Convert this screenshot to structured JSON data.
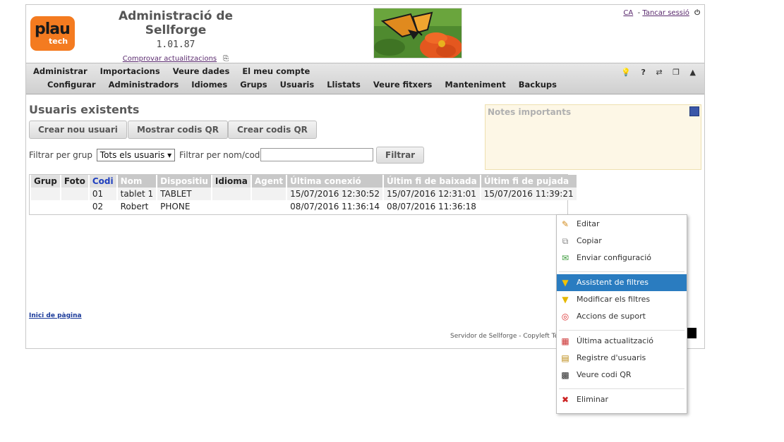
{
  "header": {
    "logo_top": "plau",
    "logo_bottom": "tech",
    "title": "Administració de Sellforge",
    "version": "1.01.87",
    "update_link": "Comprovar actualitzacions",
    "lang": "CA",
    "logout": "Tancar sessió"
  },
  "menu": {
    "row1": [
      "Administrar",
      "Importacions",
      "Veure dades",
      "El meu compte"
    ],
    "row2": [
      "Configurar",
      "Administradors",
      "Idiomes",
      "Grups",
      "Usuaris",
      "Llistats",
      "Veure fitxers",
      "Manteniment",
      "Backups"
    ]
  },
  "main": {
    "title": "Usuaris existents",
    "buttons": {
      "create_user": "Crear nou usuari",
      "show_qr": "Mostrar codis QR",
      "create_qr": "Crear codis QR",
      "filter": "Filtrar"
    },
    "filter_group_label": "Filtrar per grup",
    "filter_group_value": "Tots els usuaris",
    "filter_name_label": "Filtrar per nom/codi",
    "notes_title": "Notes importants"
  },
  "table": {
    "columns": [
      "Grup",
      "Foto",
      "Codi",
      "Nom",
      "Dispositiu",
      "Idioma",
      "Agent",
      "Última conexió",
      "Últim fi de baixada",
      "Últim fi de pujada"
    ],
    "rows": [
      [
        "",
        "",
        "01",
        "tablet 1",
        "TABLET",
        "",
        "",
        "15/07/2016 12:30:52",
        "15/07/2016 12:31:01",
        "15/07/2016 11:39:21"
      ],
      [
        "",
        "",
        "02",
        "Robert",
        "PHONE",
        "",
        "",
        "08/07/2016 11:36:14",
        "08/07/2016 11:36:18",
        ""
      ]
    ]
  },
  "footer": {
    "top_link": "Inici de pàgina",
    "copyright": "Servidor de Sellforge - Copyleft Te"
  },
  "context_menu": {
    "items": [
      {
        "label": "Editar",
        "icon": "pencil-icon"
      },
      {
        "label": "Copiar",
        "icon": "copy-icon"
      },
      {
        "label": "Enviar configuració",
        "icon": "send-config-icon"
      },
      {
        "label": "Assistent de filtres",
        "icon": "filter-icon"
      },
      {
        "label": "Modificar els filtres",
        "icon": "filter-icon"
      },
      {
        "label": "Accions de suport",
        "icon": "lifebuoy-icon"
      },
      {
        "label": "Última actualització",
        "icon": "calendar-icon"
      },
      {
        "label": "Registre d'usuaris",
        "icon": "log-icon"
      },
      {
        "label": "Veure codi QR",
        "icon": "qr-icon"
      },
      {
        "label": "Eliminar",
        "icon": "delete-icon"
      }
    ],
    "active_index": 3,
    "active_color": "#2a7cc0"
  }
}
